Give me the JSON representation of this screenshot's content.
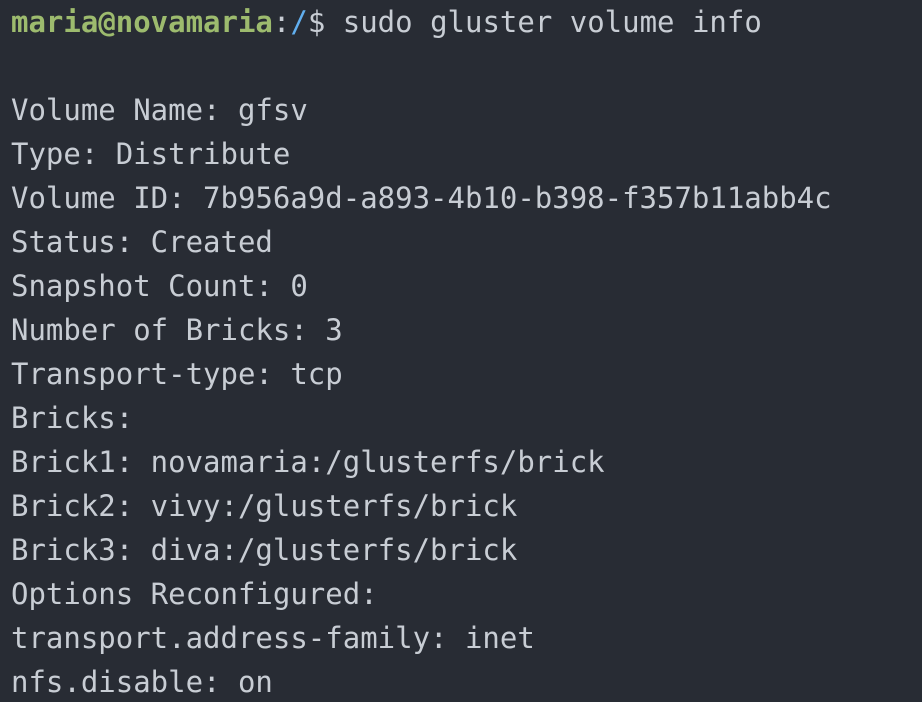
{
  "terminal": {
    "prompt": {
      "user_host": "maria@novamaria",
      "separator": ":",
      "path": "/",
      "symbol": "$ ",
      "command": "sudo gluster volume info"
    },
    "output": [
      "Volume Name: gfsv",
      "Type: Distribute",
      "Volume ID: 7b956a9d-a893-4b10-b398-f357b11abb4c",
      "Status: Created",
      "Snapshot Count: 0",
      "Number of Bricks: 3",
      "Transport-type: tcp",
      "Bricks:",
      "Brick1: novamaria:/glusterfs/brick",
      "Brick2: vivy:/glusterfs/brick",
      "Brick3: diva:/glusterfs/brick",
      "Options Reconfigured:",
      "transport.address-family: inet",
      "nfs.disable: on"
    ]
  },
  "colors": {
    "background": "#282c34",
    "text": "#c8cdd4",
    "user_host": "#9dbb6e",
    "path": "#61afef"
  }
}
